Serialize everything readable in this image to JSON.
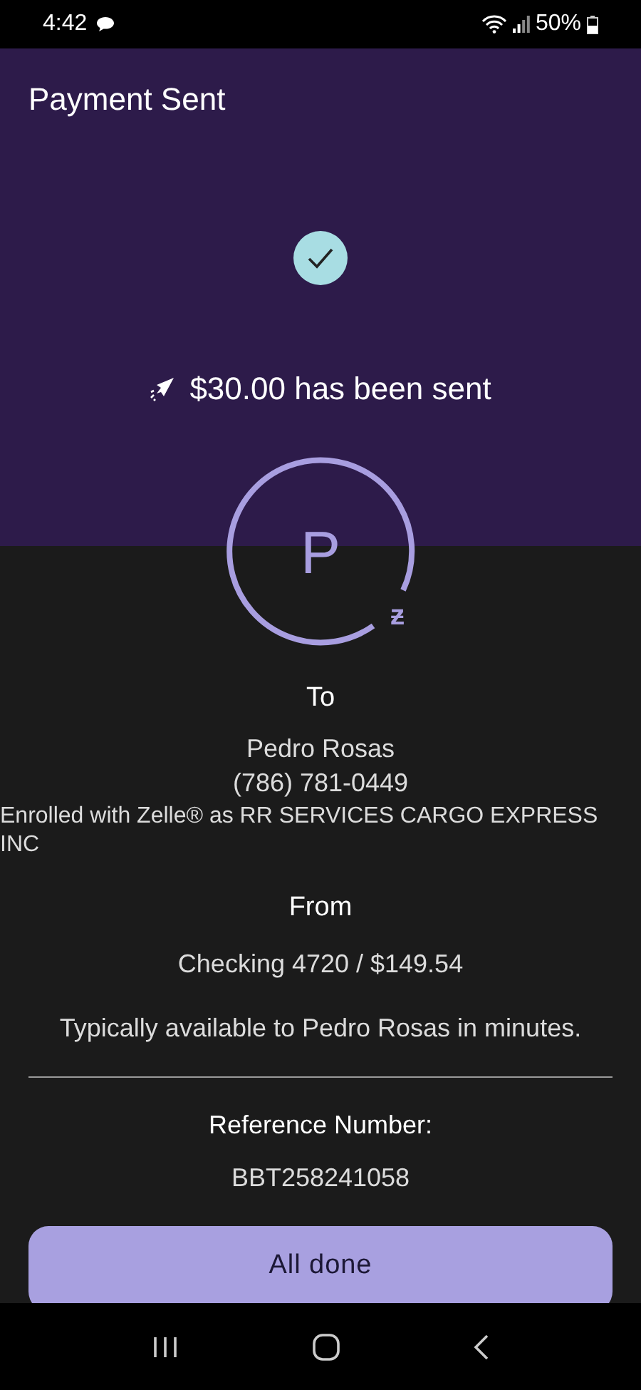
{
  "status_bar": {
    "time": "4:42",
    "battery": "50%"
  },
  "title": "Payment Sent",
  "amount_message": "$30.00 has been sent",
  "avatar": {
    "initial": "P",
    "badge": "ƶ"
  },
  "to": {
    "label": "To",
    "name": "Pedro Rosas",
    "phone": "(786) 781-0449",
    "enrolled": "Enrolled with Zelle® as RR SERVICES CARGO EXPRESS INC"
  },
  "from": {
    "label": "From",
    "account": "Checking 4720 / $149.54"
  },
  "availability": "Typically available to Pedro Rosas in minutes.",
  "reference": {
    "label": "Reference Number:",
    "number": "BBT258241058"
  },
  "button": "All done"
}
